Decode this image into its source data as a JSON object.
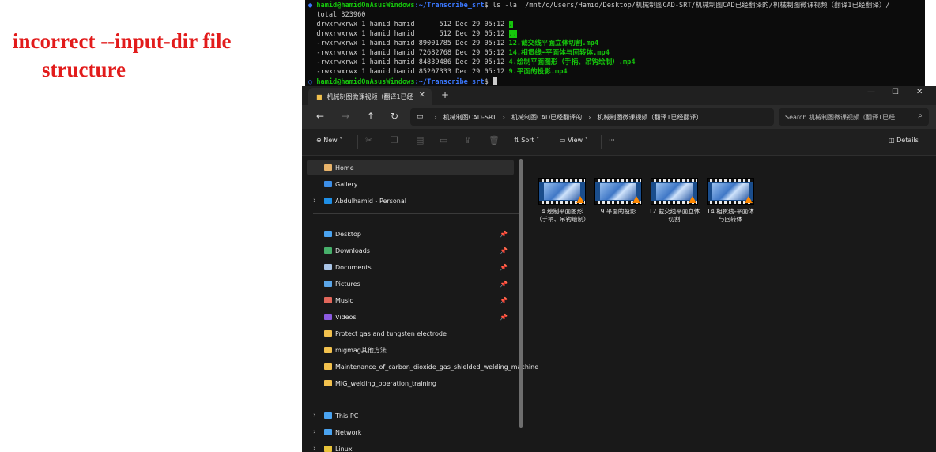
{
  "annotation": {
    "line1": "incorrect --input-dir file",
    "line2": "structure"
  },
  "terminal": {
    "prompt_user": "hamid@hamidOnAsusWindows",
    "prompt_path": ":~/Transcribe_srt",
    "command": "$ ls -la  /mnt/c/Users/Hamid/Desktop/机械制图CAD-SRT/机械制图CAD已经翻译的/机械制图微课视频（翻译1已经翻译）/",
    "total": "total 323960",
    "entries": [
      {
        "meta": "drwxrwxrwx 1 hamid hamid      512 Dec 29 05:12 ",
        "name": "."
      },
      {
        "meta": "drwxrwxrwx 1 hamid hamid      512 Dec 29 05:12 ",
        "name": ".."
      },
      {
        "meta": "-rwxrwxrwx 1 hamid hamid 89001785 Dec 29 05:12 ",
        "name": "12.截交线平面立体切割.mp4"
      },
      {
        "meta": "-rwxrwxrwx 1 hamid hamid 72682768 Dec 29 05:12 ",
        "name": "14.相贯线-平面体与回转体.mp4"
      },
      {
        "meta": "-rwxrwxrwx 1 hamid hamid 84839486 Dec 29 05:12 ",
        "name": "4.绘制平面图形（手柄、吊钩绘制）.mp4"
      },
      {
        "meta": "-rwxrwxrwx 1 hamid hamid 85207333 Dec 29 05:12 ",
        "name": "9.平面的投影.mp4"
      }
    ],
    "final_prompt_end": "$ "
  },
  "explorer": {
    "tab_title": "机械制图微课视频（翻译1已经",
    "new_tab": "+",
    "window_controls": {
      "minimize": "—",
      "maximize": "☐",
      "close": "✕"
    },
    "nav": {
      "back": "←",
      "forward": "→",
      "up": "↑",
      "refresh": "↻"
    },
    "breadcrumb": [
      "机械制图CAD-SRT",
      "机械制图CAD已经翻译的",
      "机械制图微课视频（翻译1已经翻译）"
    ],
    "search_placeholder": "Search 机械制图微课视频（翻译1已经",
    "toolbar": {
      "new": "New",
      "sort": "Sort",
      "view": "View",
      "more": "···",
      "details": "Details"
    },
    "sidebar": {
      "top": [
        {
          "label": "Home",
          "icon": "home-icon",
          "color": "#e8b36a"
        },
        {
          "label": "Gallery",
          "icon": "gallery-icon",
          "color": "#3d8ee6"
        },
        {
          "label": "Abdulhamid - Personal",
          "icon": "onedrive-icon",
          "color": "#1f8fe6"
        }
      ],
      "quick": [
        {
          "label": "Desktop",
          "icon": "desktop-icon",
          "color": "#4aa3f0",
          "pinned": true
        },
        {
          "label": "Downloads",
          "icon": "download-icon",
          "color": "#47b06b",
          "pinned": true
        },
        {
          "label": "Documents",
          "icon": "documents-icon",
          "color": "#a9c4e6",
          "pinned": true
        },
        {
          "label": "Pictures",
          "icon": "pictures-icon",
          "color": "#5ba6e8",
          "pinned": true
        },
        {
          "label": "Music",
          "icon": "music-icon",
          "color": "#e2675b",
          "pinned": true
        },
        {
          "label": "Videos",
          "icon": "videos-icon",
          "color": "#8b5ae0",
          "pinned": true
        },
        {
          "label": "Protect gas and tungsten electrode",
          "icon": "folder-icon",
          "color": "#f2c14e",
          "pinned": false
        },
        {
          "label": "migmag其他方法",
          "icon": "folder-icon",
          "color": "#f2c14e",
          "pinned": false
        },
        {
          "label": "Maintenance_of_carbon_dioxide_gas_shielded_welding_machine",
          "icon": "folder-icon",
          "color": "#f2c14e",
          "pinned": false
        },
        {
          "label": "MIG_welding_operation_training",
          "icon": "folder-icon",
          "color": "#f2c14e",
          "pinned": false
        }
      ],
      "bottom": [
        {
          "label": "This PC",
          "icon": "pc-icon",
          "color": "#4aa3f0"
        },
        {
          "label": "Network",
          "icon": "network-icon",
          "color": "#4aa3f0"
        },
        {
          "label": "Linux",
          "icon": "linux-icon",
          "color": "#e8c33a"
        }
      ],
      "pin_glyph": "📌"
    },
    "files": [
      {
        "name": "4.绘制平面图形（手柄、吊钩绘制）"
      },
      {
        "name": "9.平面的投影"
      },
      {
        "name": "12.截交线平面立体切割"
      },
      {
        "name": "14.相贯线-平面体与回转体"
      }
    ]
  }
}
